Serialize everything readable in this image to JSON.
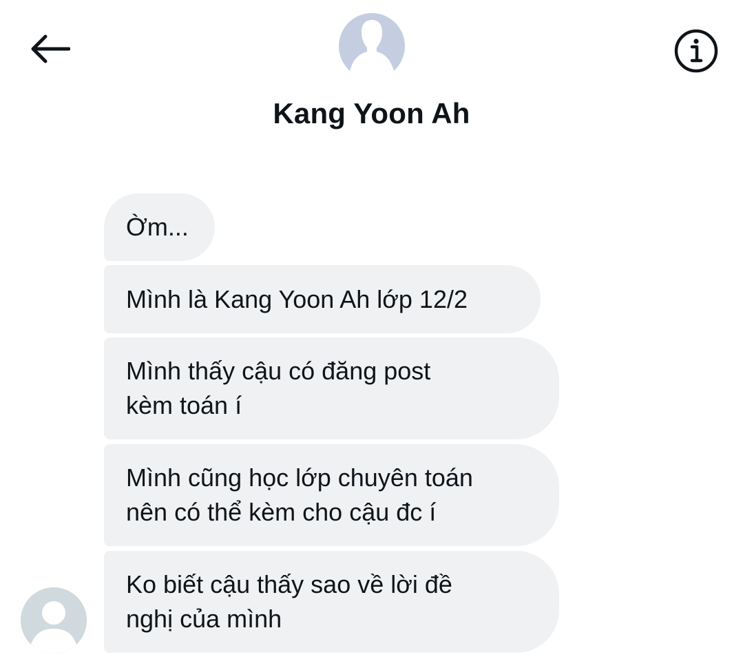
{
  "header": {
    "contact_name": "Kang Yoon Ah",
    "back_icon": "arrow-left-icon",
    "info_icon": "info-circle-icon",
    "avatar_icon": "default-profile-silhouette"
  },
  "conversation": {
    "messages": [
      {
        "lines": [
          "Ờm..."
        ]
      },
      {
        "lines": [
          "Mình là Kang Yoon Ah lớp 12/2"
        ]
      },
      {
        "lines": [
          "Mình thấy cậu có đăng post",
          "kèm toán í"
        ]
      },
      {
        "lines": [
          "Mình cũng học lớp chuyên toán",
          "nên có thể kèm cho cậu đc í"
        ]
      },
      {
        "lines": [
          "Ko biết cậu thấy sao về lời đề",
          "nghị của mình"
        ]
      }
    ]
  },
  "colors": {
    "bubble_background": "#eff1f3",
    "text": "#0f1419",
    "header_avatar": "#c5cde0",
    "message_avatar": "#cfd9de"
  }
}
